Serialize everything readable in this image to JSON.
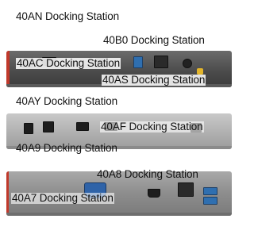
{
  "labels": {
    "l40AN": "40AN Docking Station",
    "l40B0": "40B0 Docking Station",
    "l40AC": "40AC Docking Station",
    "l40AS": "40AS Docking Station",
    "l40AY": "40AY Docking Station",
    "l40AF": "40AF Docking Station",
    "l40A9": "40A9 Docking Station",
    "l40A8": "40A8 Docking Station",
    "l40A7": "40A7 Docking Station"
  }
}
